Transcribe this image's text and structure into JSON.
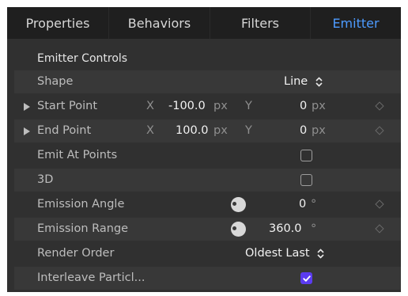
{
  "tabs": [
    {
      "label": "Properties",
      "active": false
    },
    {
      "label": "Behaviors",
      "active": false
    },
    {
      "label": "Filters",
      "active": false
    },
    {
      "label": "Emitter",
      "active": true
    }
  ],
  "section_title": "Emitter Controls",
  "rows": {
    "shape": {
      "label": "Shape",
      "value": "Line"
    },
    "start_point": {
      "label": "Start Point",
      "x_label": "X",
      "x_value": "-100.0",
      "x_unit": "px",
      "y_label": "Y",
      "y_value": "0",
      "y_unit": "px"
    },
    "end_point": {
      "label": "End Point",
      "x_label": "X",
      "x_value": "100.0",
      "x_unit": "px",
      "y_label": "Y",
      "y_value": "0",
      "y_unit": "px"
    },
    "emit_at_points": {
      "label": "Emit At Points",
      "checked": false
    },
    "three_d": {
      "label": "3D",
      "checked": false
    },
    "emission_angle": {
      "label": "Emission Angle",
      "value": "0",
      "unit": "°"
    },
    "emission_range": {
      "label": "Emission Range",
      "value": "360.0",
      "unit": "°"
    },
    "render_order": {
      "label": "Render Order",
      "value": "Oldest Last"
    },
    "interleave": {
      "label": "Interleave Particl...",
      "checked": true
    }
  },
  "colors": {
    "accent": "#4d9bff",
    "checkbox_on": "#5b3cf0",
    "panel_bg": "#303030",
    "tab_bg": "#1f1f1f"
  },
  "icons": [
    "disclosure-triangle-icon",
    "updown-arrows-icon",
    "keyframe-diamond-icon",
    "dial-icon",
    "checkmark-icon"
  ]
}
